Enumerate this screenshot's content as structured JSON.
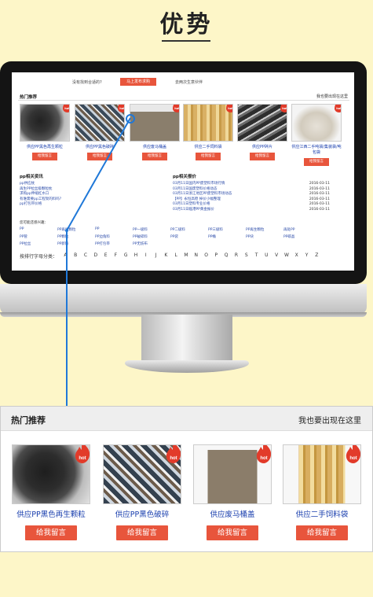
{
  "title": "优势",
  "mini": {
    "topbar_text": "没有找到合适的?",
    "topbar_button": "马上发布求购",
    "topbar_link": "去两次生意伙伴",
    "hot_title": "热门推荐",
    "hot_more": "我也要出现在这里",
    "hot_badge": "hot",
    "items": [
      {
        "caption": "供应PP黑色再生颗粒",
        "button": "给我留言"
      },
      {
        "caption": "供应PP黑色破碎",
        "button": "给我留言"
      },
      {
        "caption": "供应废马桶盖",
        "button": "给我留言"
      },
      {
        "caption": "供应二手饲料袋",
        "button": "给我留言"
      },
      {
        "caption": "供应PP碎片",
        "button": "给我留言"
      },
      {
        "caption": "供应江西二手吨袋/集装袋/吨包袋",
        "button": "给我留言"
      }
    ],
    "news_title": "pp相关资讯",
    "news": [
      "pp供应枕",
      "再生PP拉丝级颗粒枕",
      "求购pp伸缩杠水口",
      "有谁需要pp工程架的料吗？",
      "pp打包带价格"
    ],
    "prices_title": "pp相关报价",
    "prices": [
      {
        "name": "03月11日国内PP废塑料市场行情",
        "date": "2016-03-11"
      },
      {
        "name": "03月11日国废塑料价格动态",
        "date": "2016-03-11"
      },
      {
        "name": "03月11日浙江地区PP废塑料市场动态",
        "date": "2016-03-11"
      },
      {
        "name": "【PP】永恒高稳 掉价小幅整理",
        "date": "2016-03-11"
      },
      {
        "name": "03月11日塑料专业价格",
        "date": "2016-03-11"
      },
      {
        "name": "03月11日临港PP黄金报价",
        "date": "2016-03-11"
      }
    ],
    "keywords_label": "您可能还感兴趣：",
    "keywords": [
      "PP",
      "PP再生颗粒",
      "PP",
      "PP一级料",
      "PP二级料",
      "PP三级料",
      "PP再生颗粒",
      "再处PP",
      "PP管",
      "PP颗粒",
      "PP边角料",
      "PP破碎料",
      "PP袋",
      "PP桶",
      "PP块",
      "PP碳晶",
      "PP拉丝",
      "PP新料",
      "PP打包带",
      "PP无纺布"
    ],
    "alpha_label": "按排行字母分类：",
    "alphabet": [
      "A",
      "B",
      "C",
      "D",
      "E",
      "F",
      "G",
      "H",
      "I",
      "J",
      "K",
      "L",
      "M",
      "N",
      "O",
      "P",
      "Q",
      "R",
      "S",
      "T",
      "U",
      "V",
      "W",
      "X",
      "Y",
      "Z"
    ]
  },
  "zoom": {
    "hot_title": "热门推荐",
    "hot_more": "我也要出现在这里",
    "hot_badge": "hot",
    "items": [
      {
        "caption": "供应PP黑色再生颗粒",
        "button": "给我留言"
      },
      {
        "caption": "供应PP黑色破碎",
        "button": "给我留言"
      },
      {
        "caption": "供应废马桶盖",
        "button": "给我留言"
      },
      {
        "caption": "供应二手饲料袋",
        "button": "给我留言"
      }
    ]
  },
  "colors": {
    "accent": "#e8553c",
    "link": "#1a3fae",
    "background": "#fdf6c8",
    "connector": "#1f78d8"
  }
}
